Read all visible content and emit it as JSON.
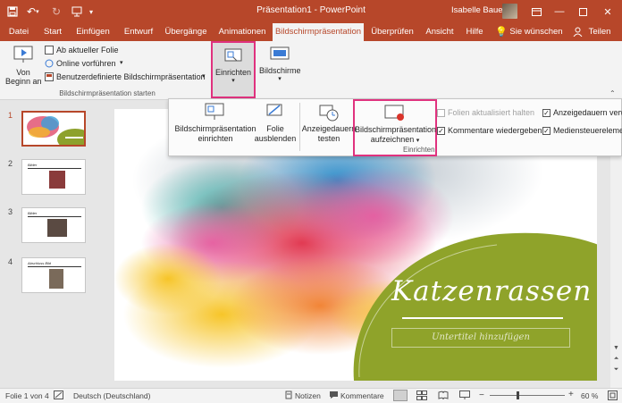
{
  "app": {
    "title": "Präsentation1  -  PowerPoint",
    "user": "Isabelle Bauer",
    "accent": "#b7472a",
    "highlight": "#e0327e"
  },
  "tabs": [
    {
      "label": "Datei"
    },
    {
      "label": "Start"
    },
    {
      "label": "Einfügen"
    },
    {
      "label": "Entwurf"
    },
    {
      "label": "Übergänge"
    },
    {
      "label": "Animationen"
    },
    {
      "label": "Bildschirmpräsentation",
      "active": true
    },
    {
      "label": "Überprüfen"
    },
    {
      "label": "Ansicht"
    },
    {
      "label": "Hilfe"
    },
    {
      "label": "Sie wünschen"
    },
    {
      "label": "Teilen"
    }
  ],
  "ribbon": {
    "von_beginn_line1": "Von",
    "von_beginn_line2": "Beginn an",
    "ab_aktueller": "Ab aktueller Folie",
    "online": "Online vorführen",
    "benutzer": "Benutzerdefinierte Bildschirmpräsentation",
    "group_start_label": "Bildschirmpräsentation starten",
    "einrichten": "Einrichten",
    "bildschirme": "Bildschirme"
  },
  "dropdown": {
    "einrichten_line1": "Bildschirmpräsentation",
    "einrichten_line2": "einrichten",
    "ausblenden_line1": "Folie",
    "ausblenden_line2": "ausblenden",
    "testen_line1": "Anzeigedauern",
    "testen_line2": "testen",
    "aufzeichnen_line1": "Bildschirmpräsentation",
    "aufzeichnen_line2": "aufzeichnen",
    "group_label": "Einrichten",
    "chk_folien": "Folien aktualisiert halten",
    "chk_kommentare": "Kommentare wiedergeben",
    "chk_anzeige": "Anzeigedauern verw",
    "chk_medien": "Mediensteuerelemen"
  },
  "thumbnails": [
    {
      "num": "1",
      "title": ""
    },
    {
      "num": "2",
      "title": "Bilder"
    },
    {
      "num": "3",
      "title": "Bilder"
    },
    {
      "num": "4",
      "title": "Abschluss Bild"
    }
  ],
  "slide": {
    "title": "Katzenrassen",
    "subtitle_placeholder": "Untertitel hinzufügen"
  },
  "status": {
    "slide_info": "Folie 1 von 4",
    "language": "Deutsch (Deutschland)",
    "notes": "Notizen",
    "comments": "Kommentare",
    "zoom": "60 %"
  }
}
